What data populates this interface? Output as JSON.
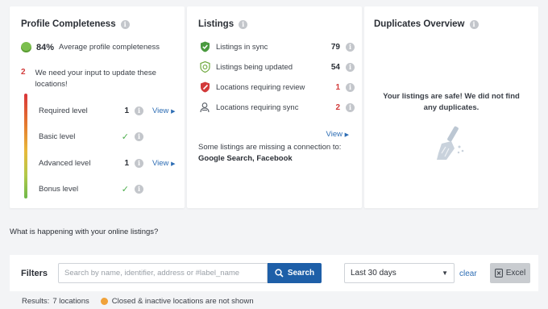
{
  "profile": {
    "title": "Profile Completeness",
    "percent": "84%",
    "average_label": "Average profile completeness",
    "input_count": "2",
    "input_text": "We need your input to update these locations!",
    "levels": [
      {
        "name": "Required level",
        "value": "1",
        "link": "View"
      },
      {
        "name": "Basic level",
        "value": "",
        "link": ""
      },
      {
        "name": "Advanced level",
        "value": "1",
        "link": "View"
      },
      {
        "name": "Bonus level",
        "value": "",
        "link": ""
      }
    ]
  },
  "listings": {
    "title": "Listings",
    "rows": [
      {
        "label": "Listings in sync",
        "value": "79"
      },
      {
        "label": "Listings being updated",
        "value": "54"
      },
      {
        "label": "Locations requiring review",
        "value": "1"
      },
      {
        "label": "Locations requiring sync",
        "value": "2"
      }
    ],
    "view_link": "View",
    "missing_text": "Some listings are missing a connection to:",
    "missing_platforms": "Google Search, Facebook"
  },
  "duplicates": {
    "title": "Duplicates Overview",
    "message": "Your listings are safe! We did not find any duplicates."
  },
  "question": "What is happening with your online listings?",
  "filters": {
    "label": "Filters",
    "search_placeholder": "Search by name, identifier, address or #label_name",
    "search_button": "Search",
    "period": "Last 30 days",
    "clear": "clear",
    "excel": "Excel"
  },
  "results": {
    "label": "Results:",
    "count": "7 locations",
    "note": "Closed & inactive locations are not shown"
  },
  "colors": {
    "accent": "#1e5fa8",
    "link": "#2d6db4",
    "alert_red": "#d23a3a",
    "success_green": "#4cae4c",
    "warning_orange": "#f0a23a"
  }
}
